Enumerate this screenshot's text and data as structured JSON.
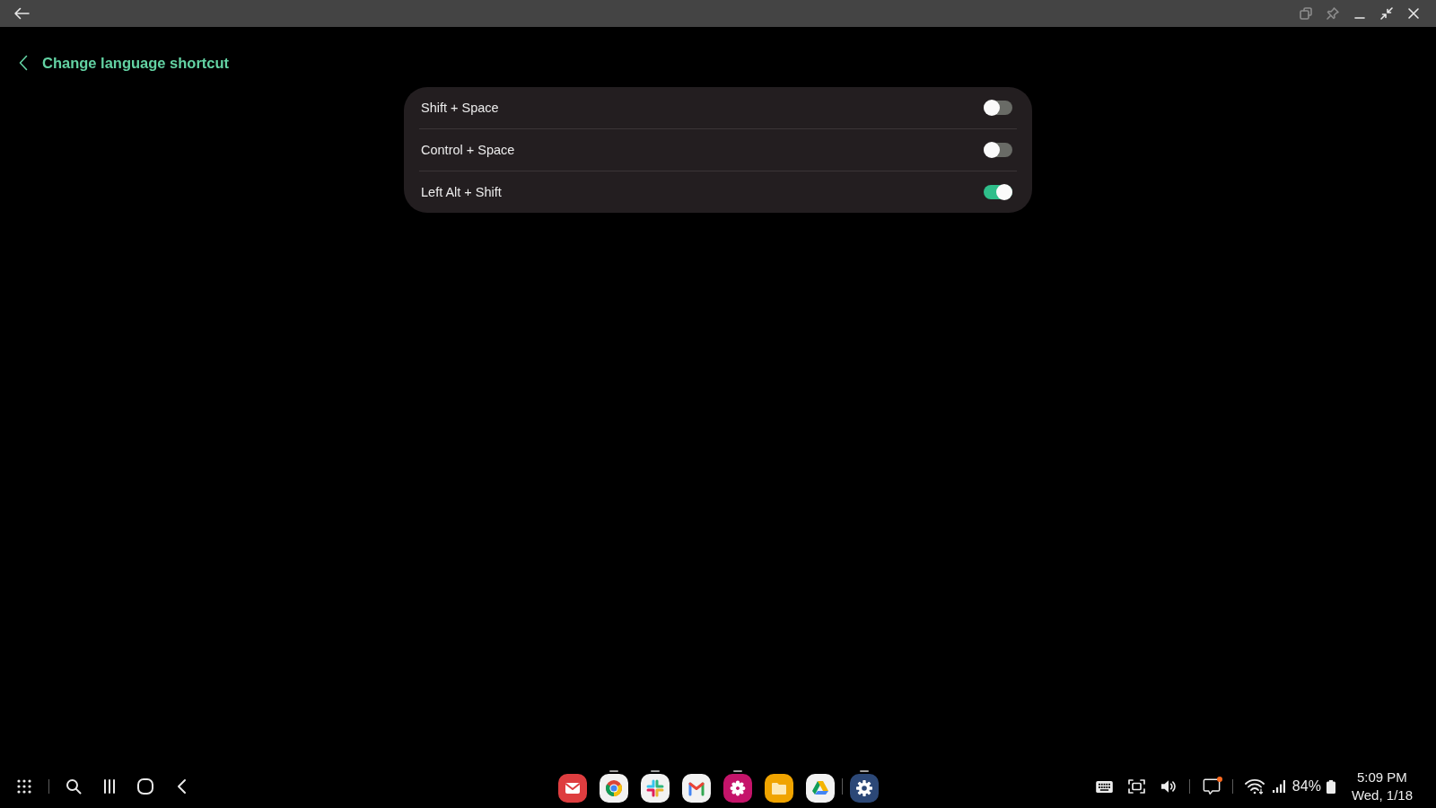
{
  "window": {
    "controls": [
      {
        "kind": "pop-up",
        "disabled": true
      },
      {
        "kind": "pin",
        "disabled": true
      },
      {
        "kind": "minimize",
        "disabled": false
      },
      {
        "kind": "restore",
        "disabled": false
      },
      {
        "kind": "close",
        "disabled": false
      }
    ]
  },
  "header": {
    "title": "Change language shortcut"
  },
  "shortcuts": [
    {
      "label": "Shift + Space",
      "on": false
    },
    {
      "label": "Control + Space",
      "on": false
    },
    {
      "label": "Left Alt + Shift",
      "on": true
    }
  ],
  "taskbar": {
    "pinned_apps": [
      {
        "kind": "envelope",
        "running": false
      },
      {
        "kind": "ring",
        "running": true
      },
      {
        "kind": "hash",
        "running": true
      },
      {
        "kind": "letter-m",
        "running": false
      },
      {
        "kind": "flower",
        "running": true
      },
      {
        "kind": "folder",
        "running": false
      },
      {
        "kind": "triangle",
        "running": false
      }
    ],
    "recent_apps": [
      {
        "kind": "gear",
        "running": true
      }
    ],
    "notifications_unread": true,
    "battery": "84%",
    "time": "5:09 PM",
    "date": "Wed, 1/18"
  }
}
